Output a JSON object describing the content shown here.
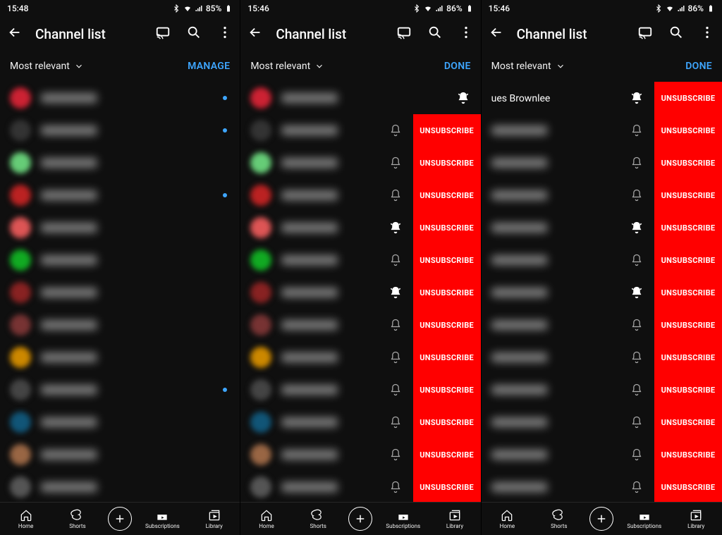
{
  "status_icons": {
    "bluetooth": "bt",
    "wifi": "wifi",
    "signal": "sig",
    "battery_icon": "bat"
  },
  "panels": [
    {
      "time": "15:48",
      "battery": "85%",
      "title": "Channel list",
      "filter": "Most relevant",
      "action": "MANAGE",
      "mode": "manage",
      "offset": false,
      "rows": [
        {
          "avatar": "#c23",
          "name": "",
          "dot": true,
          "bell": "",
          "unsub": false
        },
        {
          "avatar": "#333",
          "name": "",
          "dot": true,
          "bell": "",
          "unsub": false
        },
        {
          "avatar": "#6c7",
          "name": "",
          "dot": false,
          "bell": "",
          "unsub": false
        },
        {
          "avatar": "#b22",
          "name": "",
          "dot": true,
          "bell": "",
          "unsub": false
        },
        {
          "avatar": "#d55",
          "name": "",
          "dot": false,
          "bell": "",
          "unsub": false
        },
        {
          "avatar": "#1a2",
          "name": "",
          "dot": false,
          "bell": "",
          "unsub": false
        },
        {
          "avatar": "#822",
          "name": "",
          "dot": false,
          "bell": "",
          "unsub": false
        },
        {
          "avatar": "#733",
          "name": "",
          "dot": false,
          "bell": "",
          "unsub": false
        },
        {
          "avatar": "#c80",
          "name": "",
          "dot": false,
          "bell": "",
          "unsub": false
        },
        {
          "avatar": "#444",
          "name": "",
          "dot": true,
          "bell": "",
          "unsub": false
        },
        {
          "avatar": "#157",
          "name": "",
          "dot": false,
          "bell": "",
          "unsub": false
        },
        {
          "avatar": "#964",
          "name": "",
          "dot": false,
          "bell": "",
          "unsub": false
        },
        {
          "avatar": "#555",
          "name": "",
          "dot": false,
          "bell": "",
          "unsub": false
        }
      ]
    },
    {
      "time": "15:46",
      "battery": "86%",
      "title": "Channel list",
      "filter": "Most relevant",
      "action": "DONE",
      "mode": "done",
      "offset": false,
      "rows": [
        {
          "avatar": "#c23",
          "name": "",
          "dot": false,
          "bell": "filled",
          "unsub": false
        },
        {
          "avatar": "#333",
          "name": "",
          "dot": false,
          "bell": "outline",
          "unsub": true
        },
        {
          "avatar": "#6c7",
          "name": "",
          "dot": false,
          "bell": "outline",
          "unsub": true
        },
        {
          "avatar": "#b22",
          "name": "",
          "dot": false,
          "bell": "outline",
          "unsub": true
        },
        {
          "avatar": "#d55",
          "name": "",
          "dot": false,
          "bell": "filled",
          "unsub": true
        },
        {
          "avatar": "#1a2",
          "name": "",
          "dot": false,
          "bell": "outline",
          "unsub": true
        },
        {
          "avatar": "#822",
          "name": "",
          "dot": false,
          "bell": "filled",
          "unsub": true
        },
        {
          "avatar": "#733",
          "name": "",
          "dot": false,
          "bell": "outline",
          "unsub": true
        },
        {
          "avatar": "#c80",
          "name": "",
          "dot": false,
          "bell": "outline",
          "unsub": true
        },
        {
          "avatar": "#444",
          "name": "",
          "dot": false,
          "bell": "outline",
          "unsub": true
        },
        {
          "avatar": "#157",
          "name": "",
          "dot": false,
          "bell": "outline",
          "unsub": true
        },
        {
          "avatar": "#964",
          "name": "",
          "dot": false,
          "bell": "outline",
          "unsub": true
        },
        {
          "avatar": "#555",
          "name": "",
          "dot": false,
          "bell": "outline",
          "unsub": true
        }
      ]
    },
    {
      "time": "15:46",
      "battery": "86%",
      "title": "Channel list",
      "filter": "Most relevant",
      "action": "DONE",
      "mode": "done",
      "offset": true,
      "rows": [
        {
          "avatar": "",
          "name": "ues Brownlee",
          "clear": true,
          "dot": false,
          "bell": "filled",
          "unsub": true
        },
        {
          "avatar": "",
          "name": "",
          "dot": false,
          "bell": "outline",
          "unsub": true
        },
        {
          "avatar": "",
          "name": "",
          "dot": false,
          "bell": "outline",
          "unsub": true
        },
        {
          "avatar": "",
          "name": "",
          "dot": false,
          "bell": "outline",
          "unsub": true
        },
        {
          "avatar": "",
          "name": "",
          "dot": false,
          "bell": "filled",
          "unsub": true
        },
        {
          "avatar": "",
          "name": "",
          "dot": false,
          "bell": "outline",
          "unsub": true
        },
        {
          "avatar": "",
          "name": "",
          "dot": false,
          "bell": "filled",
          "unsub": true
        },
        {
          "avatar": "",
          "name": "",
          "dot": false,
          "bell": "outline",
          "unsub": true
        },
        {
          "avatar": "",
          "name": "",
          "dot": false,
          "bell": "outline",
          "unsub": true
        },
        {
          "avatar": "",
          "name": "",
          "dot": false,
          "bell": "outline",
          "unsub": true
        },
        {
          "avatar": "",
          "name": "",
          "dot": false,
          "bell": "outline",
          "unsub": true
        },
        {
          "avatar": "",
          "name": "",
          "dot": false,
          "bell": "outline",
          "unsub": true
        },
        {
          "avatar": "",
          "name": "",
          "dot": false,
          "bell": "outline",
          "unsub": true
        }
      ]
    }
  ],
  "unsub_label": "UNSUBSCRIBE",
  "nav": {
    "home": "Home",
    "shorts": "Shorts",
    "subs": "Subscriptions",
    "library": "Library"
  }
}
